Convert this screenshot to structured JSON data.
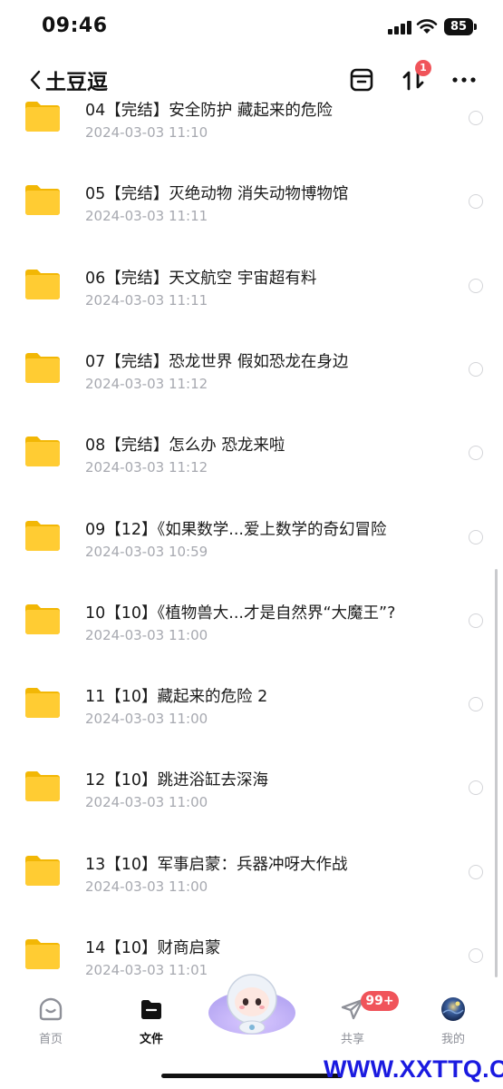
{
  "status_bar": {
    "time": "09:46",
    "battery": "85"
  },
  "nav": {
    "back_title": "土豆逗",
    "transfer_badge": "1"
  },
  "files": [
    {
      "name": "04【完结】安全防护 藏起来的危险",
      "date": "2024-03-03 11:10"
    },
    {
      "name": "05【完结】灭绝动物 消失动物博物馆",
      "date": "2024-03-03 11:11"
    },
    {
      "name": "06【完结】天文航空 宇宙超有料",
      "date": "2024-03-03 11:11"
    },
    {
      "name": "07【完结】恐龙世界 假如恐龙在身边",
      "date": "2024-03-03 11:12"
    },
    {
      "name": "08【完结】怎么办 恐龙来啦",
      "date": "2024-03-03 11:12"
    },
    {
      "name": "09【12】《如果数学...爱上数学的奇幻冒险",
      "date": "2024-03-03 10:59"
    },
    {
      "name": "10【10】《植物兽大...才是自然界“大魔王”?",
      "date": "2024-03-03 11:00"
    },
    {
      "name": "11【10】藏起来的危险 2",
      "date": "2024-03-03 11:00"
    },
    {
      "name": "12【10】跳进浴缸去深海",
      "date": "2024-03-03 11:00"
    },
    {
      "name": "13【10】军事启蒙：兵器冲呀大作战",
      "date": "2024-03-03 11:00"
    },
    {
      "name": "14【10】财商启蒙",
      "date": "2024-03-03 11:01"
    }
  ],
  "tabs": [
    {
      "label": "首页",
      "icon": "home-icon"
    },
    {
      "label": "文件",
      "icon": "folder-icon"
    },
    {
      "label": "共享",
      "icon": "paper-plane-icon"
    },
    {
      "label": "我的",
      "icon": "avatar-icon"
    }
  ],
  "share_badge": "99+",
  "watermark": "WWW.XXTTQ.COM",
  "colors": {
    "folder": "#ffcc33",
    "badge": "#f0545a",
    "date_text": "#a7a9b0",
    "watermark": "#1a1ae0"
  }
}
